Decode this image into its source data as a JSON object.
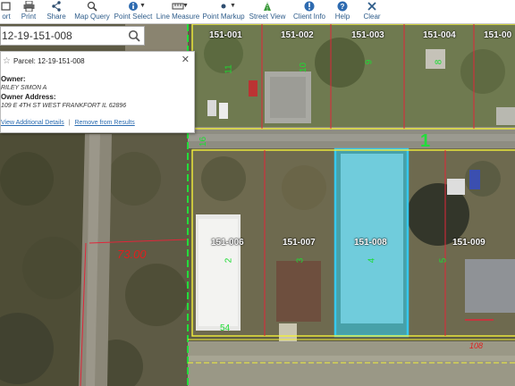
{
  "toolbar": {
    "items": [
      {
        "label": "ort",
        "icon": "export-icon"
      },
      {
        "label": "Print",
        "icon": "print-icon"
      },
      {
        "label": "Share",
        "icon": "share-icon"
      },
      {
        "label": "Map Query",
        "icon": "map-query-icon"
      },
      {
        "label": "Point Select",
        "icon": "point-select-icon"
      },
      {
        "label": "Line Measure",
        "icon": "line-measure-icon"
      },
      {
        "label": "Point Markup",
        "icon": "point-markup-icon"
      },
      {
        "label": "Street View",
        "icon": "street-view-icon"
      },
      {
        "label": "Client Info",
        "icon": "client-info-icon"
      },
      {
        "label": "Help",
        "icon": "help-icon"
      },
      {
        "label": "Clear",
        "icon": "clear-icon"
      }
    ]
  },
  "search": {
    "value": "12-19-151-008",
    "icon": "search-icon"
  },
  "popup": {
    "title": "Parcel: 12-19-151-008",
    "owner_label": "Owner:",
    "owner_value": "RILEY SIMON A",
    "address_label": "Owner Address:",
    "address_value": "109 E 4TH ST WEST FRANKFORT IL 62896",
    "link_details": "View Additional Details",
    "link_separator": "|",
    "link_remove": "Remove from Results",
    "close_icon": "close-icon",
    "star_icon": "star-icon"
  },
  "map": {
    "parcel_labels": [
      "151-001",
      "151-002",
      "151-003",
      "151-004",
      "151-00",
      "151-006",
      "151-007",
      "151-008",
      "151-009"
    ],
    "lot_numbers": [
      "11",
      "10",
      "9",
      "8",
      "16",
      "2",
      "3",
      "4",
      "5",
      "54"
    ],
    "block_number": "1",
    "dimension_big": "73.00",
    "dimension_small": "108",
    "colors": {
      "selected_parcel": "#2ec4e0",
      "block_outline": "#f3f03a",
      "parcel_line": "#e0263a",
      "lot_text": "#1ddc33"
    }
  }
}
